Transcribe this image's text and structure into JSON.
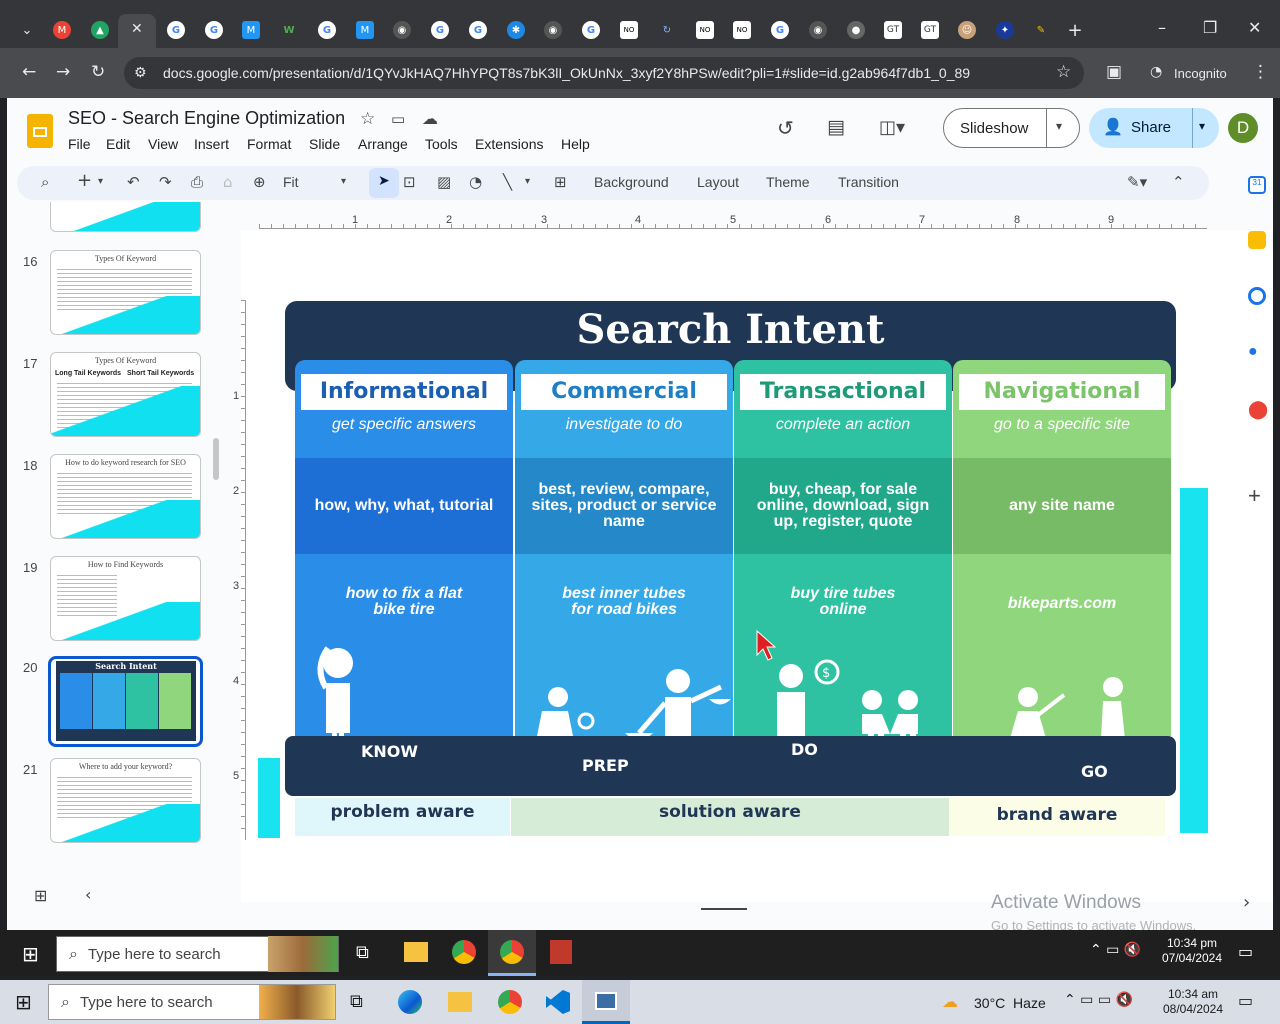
{
  "browser": {
    "url": "docs.google.com/presentation/d/1QYvJkHAQ7HhYPQT8s7bK3lI_OkUnNx_3xyf2Y8hPSw/edit?pli=1#slide=id.g2ab964f7db1_0_89",
    "incognito_label": "Incognito"
  },
  "docs": {
    "title": "SEO - Search Engine Optimization",
    "menus": [
      "File",
      "Edit",
      "View",
      "Insert",
      "Format",
      "Slide",
      "Arrange",
      "Tools",
      "Extensions",
      "Help"
    ],
    "slideshow_label": "Slideshow",
    "share_label": "Share",
    "avatar_letter": "D",
    "zoom_label": "Fit",
    "toolbar": {
      "background": "Background",
      "layout": "Layout",
      "theme": "Theme",
      "transition": "Transition"
    }
  },
  "filmstrip": {
    "slides": [
      {
        "num": "16",
        "title": "Types Of Keyword"
      },
      {
        "num": "17",
        "title": "Types Of Keyword",
        "col1": "Long Tail Keywords",
        "col2": "Short Tail Keywords"
      },
      {
        "num": "18",
        "title": "How to do keyword research for SEO"
      },
      {
        "num": "19",
        "title": "How to Find Keywords"
      },
      {
        "num": "20",
        "title": "Search Intent"
      },
      {
        "num": "21",
        "title": "Where to add your keyword?"
      }
    ]
  },
  "ruler": [
    "1",
    "2",
    "3",
    "4",
    "5",
    "6",
    "7",
    "8",
    "9"
  ],
  "ruler_v": [
    "1",
    "2",
    "3",
    "4",
    "5"
  ],
  "slide": {
    "title": "Search Intent",
    "columns": [
      {
        "head": "Informational",
        "sub": "get specific answers",
        "band": "how, why, what, tutorial",
        "example": "how to fix a flat bike tire",
        "color": "#2a8ee8",
        "band_color": "#1d6fd6",
        "head_color": "#1b5fb5"
      },
      {
        "head": "Commercial",
        "sub": "investigate to do",
        "band": "best, review, compare, sites, product or service name",
        "example": "best inner tubes for road bikes",
        "color": "#35a8e8",
        "band_color": "#2589c9",
        "head_color": "#1f7fc4"
      },
      {
        "head": "Transactional",
        "sub": "complete an action",
        "band": "buy, cheap, for sale online, download, sign up, register, quote",
        "example": "buy tire tubes online",
        "color": "#2fc2a2",
        "band_color": "#21a78a",
        "head_color": "#1e9a77"
      },
      {
        "head": "Navigational",
        "sub": "go to a specific site",
        "band": "any site name",
        "example": "bikeparts.com",
        "color": "#8fd67c",
        "band_color": "#78bb67",
        "head_color": "#7cc46a"
      }
    ],
    "stages": {
      "know": "KNOW",
      "prep": "PREP",
      "do": "DO",
      "go": "GO"
    },
    "awareness": {
      "problem": "problem aware",
      "solution": "solution aware",
      "brand": "brand aware"
    }
  },
  "watermark": {
    "line1": "Activate Windows",
    "line2": "Go to Settings to activate Windows."
  },
  "taskbar_inner": {
    "search": "Type here to search",
    "time": "10:34 pm",
    "date": "07/04/2024"
  },
  "taskbar_outer": {
    "search": "Type here to search",
    "weather": "30°C  Haze",
    "time": "10:34 am",
    "date": "08/04/2024"
  }
}
